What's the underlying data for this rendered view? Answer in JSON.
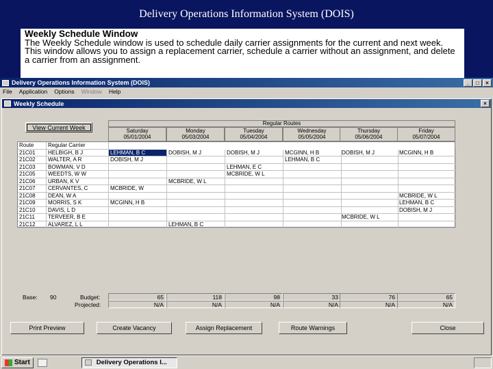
{
  "slide": {
    "title": "Delivery Operations Information System (DOIS)",
    "callout_title": "Weekly Schedule Window",
    "callout_text": "The Weekly Schedule window is used to schedule daily carrier assignments for the current and next week.  This window allows you to assign a replacement carrier, schedule a carrier without an assignment, and delete a carrier from an assignment."
  },
  "app": {
    "title": "Delivery Operations Information System (DOIS)",
    "menu": [
      "File",
      "Application",
      "Options",
      "Window",
      "Help"
    ],
    "child_title": "Weekly Schedule"
  },
  "schedule": {
    "view_button": "View Current Week",
    "group_label": "Regular Routes",
    "days": [
      {
        "name": "Saturday",
        "date": "05/01/2004"
      },
      {
        "name": "Monday",
        "date": "05/03/2004"
      },
      {
        "name": "Tuesday",
        "date": "05/04/2004"
      },
      {
        "name": "Wednesday",
        "date": "05/05/2004"
      },
      {
        "name": "Thursday",
        "date": "05/06/2004"
      },
      {
        "name": "Friday",
        "date": "05/07/2004"
      }
    ],
    "col_route": "Route",
    "col_carrier": "Regular Carrier",
    "rows": [
      {
        "route": "21C01",
        "carrier": "HELBIGH, B J",
        "cells": [
          "LEHMAN, B C",
          "DOBISH, M J",
          "DOBISH, M J",
          "MCGINN, H B",
          "DOBISH, M J",
          "MCGINN, H B"
        ]
      },
      {
        "route": "21C02",
        "carrier": "WALTER, A R",
        "cells": [
          "DOBISH, M J",
          "",
          "",
          "LEHMAN, B C",
          "",
          ""
        ]
      },
      {
        "route": "21C03",
        "carrier": "BOWMAN, V D",
        "cells": [
          "",
          "",
          "LEHMAN, E C",
          "",
          "",
          ""
        ]
      },
      {
        "route": "21C05",
        "carrier": "WEEDTS, W W",
        "cells": [
          "",
          "",
          "MCBRIDE, W L",
          "",
          "",
          ""
        ]
      },
      {
        "route": "21C06",
        "carrier": "URBAN, K V",
        "cells": [
          "",
          "MCBRIDE, W L",
          "",
          "",
          "",
          ""
        ]
      },
      {
        "route": "21C07",
        "carrier": "CERVANTES, C",
        "cells": [
          "MCBRIDE, W",
          "",
          "",
          "",
          "",
          ""
        ]
      },
      {
        "route": "21C08",
        "carrier": "DEAN, W A",
        "cells": [
          "",
          "",
          "",
          "",
          "",
          "MCBRIDE, W L"
        ]
      },
      {
        "route": "21C09",
        "carrier": "MORRIS, S K",
        "cells": [
          "MCGINN, H B",
          "",
          "",
          "",
          "",
          "LEHMAN, B C"
        ]
      },
      {
        "route": "21C10",
        "carrier": "DAVIS, L D",
        "cells": [
          "",
          "",
          "",
          "",
          "",
          "DOBISH, M J"
        ]
      },
      {
        "route": "21C11",
        "carrier": "TERVEER, B E",
        "cells": [
          "",
          "",
          "",
          "",
          "MCBRIDE, W L",
          ""
        ]
      },
      {
        "route": "21C12",
        "carrier": "ALVAREZ, L L",
        "cells": [
          "",
          "LEHMAN, B C",
          "",
          "",
          "",
          ""
        ]
      }
    ],
    "base_label": "Base:",
    "base_value": "90",
    "budget_label": "Budget:",
    "projected_label": "Projected:",
    "budget": [
      "65",
      "118",
      "98",
      "33",
      "76",
      "65"
    ],
    "projected": [
      "N/A",
      "N/A",
      "N/A",
      "N/A",
      "N/A",
      "N/A"
    ]
  },
  "buttons": {
    "print": "Print Preview",
    "vacancy": "Create Vacancy",
    "assign": "Assign Replacement",
    "warnings": "Route Warnings",
    "close": "Close"
  },
  "taskbar": {
    "start": "Start",
    "task": "Delivery Operations I..."
  }
}
